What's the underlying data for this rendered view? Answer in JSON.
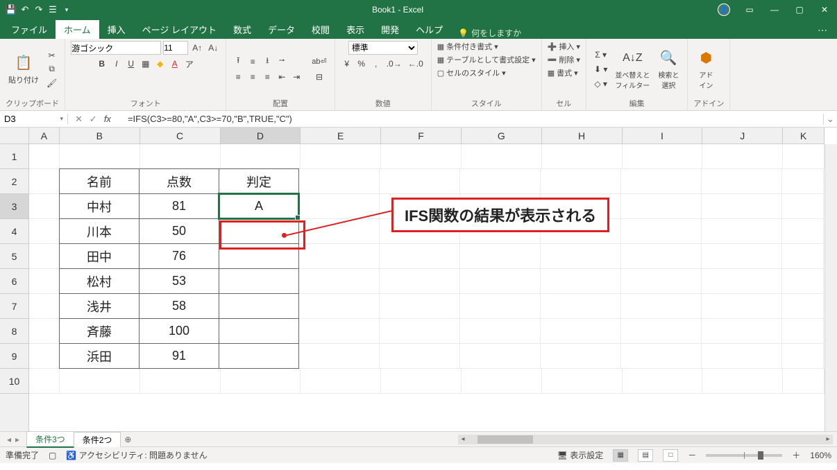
{
  "app": {
    "title": "Book1 - Excel"
  },
  "qat": {
    "save": "save",
    "undo": "undo",
    "redo": "redo",
    "touch": "touch"
  },
  "tabs": {
    "file": "ファイル",
    "home": "ホーム",
    "insert": "挿入",
    "pagelayout": "ページ レイアウト",
    "formulas": "数式",
    "data": "データ",
    "review": "校閲",
    "view": "表示",
    "developer": "開発",
    "help": "ヘルプ",
    "tellme": "何をしますか"
  },
  "ribbon": {
    "clipboard": {
      "paste": "貼り付け",
      "label": "クリップボード"
    },
    "font": {
      "name": "游ゴシック",
      "size": "11",
      "label": "フォント"
    },
    "alignment": {
      "wrap": "折り返して全体を表示する",
      "merge": "セルを結合して中央揃え",
      "label": "配置"
    },
    "number": {
      "format": "標準",
      "label": "数値"
    },
    "styles": {
      "cond": "条件付き書式",
      "table": "テーブルとして書式設定",
      "cell": "セルのスタイル",
      "label": "スタイル"
    },
    "cells": {
      "insert": "挿入",
      "delete": "削除",
      "format": "書式",
      "label": "セル"
    },
    "editing": {
      "sort": "並べ替えと\nフィルター",
      "find": "検索と\n選択",
      "label": "編集"
    },
    "addins": {
      "addin": "アド\nイン",
      "label": "アドイン"
    }
  },
  "namebox": "D3",
  "formula": "=IFS(C3>=80,\"A\",C3>=70,\"B\",TRUE,\"C\")",
  "columns": [
    "A",
    "B",
    "C",
    "D",
    "E",
    "F",
    "G",
    "H",
    "I",
    "J",
    "K"
  ],
  "rows": [
    "1",
    "2",
    "3",
    "4",
    "5",
    "6",
    "7",
    "8",
    "9",
    "10"
  ],
  "table": {
    "headers": {
      "b2": "名前",
      "c2": "点数",
      "d2": "判定"
    },
    "data": [
      {
        "name": "中村",
        "score": "81",
        "grade": "A"
      },
      {
        "name": "川本",
        "score": "50",
        "grade": ""
      },
      {
        "name": "田中",
        "score": "76",
        "grade": ""
      },
      {
        "name": "松村",
        "score": "53",
        "grade": ""
      },
      {
        "name": "浅井",
        "score": "58",
        "grade": ""
      },
      {
        "name": "斉藤",
        "score": "100",
        "grade": ""
      },
      {
        "name": "浜田",
        "score": "91",
        "grade": ""
      }
    ]
  },
  "callout": "IFS関数の結果が表示される",
  "sheets": {
    "s1": "条件3つ",
    "s2": "条件2つ"
  },
  "status": {
    "ready": "準備完了",
    "access": "アクセシビリティ: 問題ありません",
    "display": "表示設定",
    "zoom": "160%"
  }
}
